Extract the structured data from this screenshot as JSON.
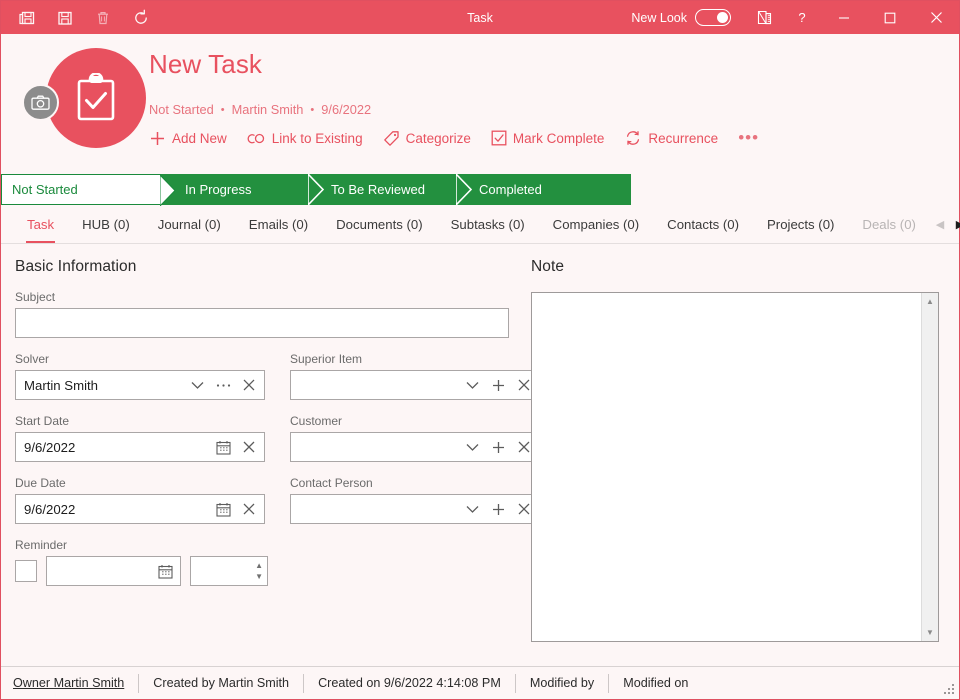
{
  "window": {
    "title": "Task",
    "toolbar": [
      {
        "name": "save-and-new",
        "label": "Save and New",
        "icon": "save-copy-icon",
        "disabled": false
      },
      {
        "name": "save",
        "label": "Save",
        "icon": "save-icon",
        "disabled": false
      },
      {
        "name": "delete",
        "label": "Delete",
        "icon": "trash-icon",
        "disabled": true
      },
      {
        "name": "refresh",
        "label": "Refresh",
        "icon": "refresh-icon",
        "disabled": false
      }
    ],
    "new_look_label": "New Look",
    "new_look_on": true,
    "design_icon": "ruler-pencil-icon",
    "help_label": "?",
    "minimize_label": "—",
    "maximize_label": "□",
    "close_label": "✕"
  },
  "header": {
    "title": "New Task",
    "avatar_icon": "clipboard-check-icon",
    "camera_badge_icon": "camera-icon",
    "meta": {
      "status": "Not Started",
      "owner": "Martin Smith",
      "date": "9/6/2022",
      "separator": "•"
    },
    "actions": [
      {
        "name": "add-new",
        "label": "Add New",
        "icon": "plus-icon"
      },
      {
        "name": "link-to-existing",
        "label": "Link to Existing",
        "icon": "link-icon"
      },
      {
        "name": "categorize",
        "label": "Categorize",
        "icon": "tag-icon"
      },
      {
        "name": "mark-complete",
        "label": "Mark Complete",
        "icon": "checkbox-icon"
      },
      {
        "name": "recurrence",
        "label": "Recurrence",
        "icon": "recurrence-icon"
      }
    ],
    "more_label": "•••"
  },
  "stages": {
    "current": "Not Started",
    "items": [
      {
        "label": "Not Started",
        "state": "current"
      },
      {
        "label": "In Progress",
        "state": "available"
      },
      {
        "label": "To Be Reviewed",
        "state": "available"
      },
      {
        "label": "Completed",
        "state": "available"
      }
    ]
  },
  "tabs": {
    "active": "Task",
    "items": [
      {
        "label": "Task",
        "active": true,
        "faded": false
      },
      {
        "label": "HUB (0)",
        "active": false,
        "faded": false
      },
      {
        "label": "Journal (0)",
        "active": false,
        "faded": false
      },
      {
        "label": "Emails (0)",
        "active": false,
        "faded": false
      },
      {
        "label": "Documents (0)",
        "active": false,
        "faded": false
      },
      {
        "label": "Subtasks (0)",
        "active": false,
        "faded": false
      },
      {
        "label": "Companies (0)",
        "active": false,
        "faded": false
      },
      {
        "label": "Contacts (0)",
        "active": false,
        "faded": false
      },
      {
        "label": "Projects (0)",
        "active": false,
        "faded": false
      },
      {
        "label": "Deals (0)",
        "active": false,
        "faded": true
      }
    ],
    "scroll_left": "◀",
    "scroll_right": "▶"
  },
  "form": {
    "section_title": "Basic Information",
    "subject": {
      "label": "Subject",
      "value": "",
      "placeholder": ""
    },
    "solver": {
      "label": "Solver",
      "value": "Martin Smith",
      "icons": [
        "chevron-down-icon",
        "ellipsis-icon",
        "clear-icon"
      ]
    },
    "superior_item": {
      "label": "Superior Item",
      "value": "",
      "icons": [
        "chevron-down-icon",
        "plus-icon",
        "clear-icon"
      ]
    },
    "start_date": {
      "label": "Start Date",
      "value": "9/6/2022",
      "icons": [
        "calendar-icon",
        "clear-icon"
      ]
    },
    "customer": {
      "label": "Customer",
      "value": "",
      "icons": [
        "chevron-down-icon",
        "plus-icon",
        "clear-icon"
      ]
    },
    "due_date": {
      "label": "Due Date",
      "value": "9/6/2022",
      "icons": [
        "calendar-icon",
        "clear-icon"
      ]
    },
    "contact_person": {
      "label": "Contact Person",
      "value": "",
      "icons": [
        "chevron-down-icon",
        "plus-icon",
        "clear-icon"
      ]
    },
    "reminder": {
      "label": "Reminder",
      "checked": false,
      "date_value": "",
      "time_value": ""
    }
  },
  "note": {
    "title": "Note",
    "value": "",
    "scroll_up": "▲",
    "scroll_down": "▼"
  },
  "statusbar": {
    "items": [
      {
        "label": "Owner Martin Smith",
        "link": true
      },
      {
        "label": "Created by Martin Smith",
        "link": false
      },
      {
        "label": "Created on 9/6/2022 4:14:08 PM",
        "link": false
      },
      {
        "label": "Modified by",
        "link": false
      },
      {
        "label": "Modified on",
        "link": false
      }
    ]
  },
  "colors": {
    "accent_red": "#e8515f",
    "stage_green": "#23903f",
    "stage_green_text": "#1a8a3c",
    "header_bg": "#fdf6f6",
    "field_border": "#aaa6a6"
  }
}
